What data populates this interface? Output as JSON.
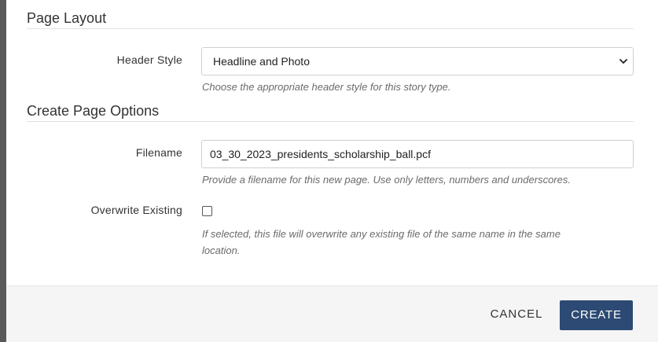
{
  "sections": {
    "page_layout": {
      "title": "Page Layout",
      "header_style": {
        "label": "Header Style",
        "selected": "Headline and Photo",
        "help": "Choose the appropriate header style for this story type."
      }
    },
    "create_page_options": {
      "title": "Create Page Options",
      "filename": {
        "label": "Filename",
        "value": "03_30_2023_presidents_scholarship_ball.pcf",
        "help": "Provide a filename for this new page. Use only letters, numbers and underscores."
      },
      "overwrite": {
        "label": "Overwrite Existing",
        "checked": false,
        "help_line1": "If selected, this file will overwrite any existing file of the same name in the same",
        "help_line2": "location."
      }
    }
  },
  "footer": {
    "cancel_label": "CANCEL",
    "create_label": "CREATE"
  },
  "colors": {
    "primary_button": "#2c4a73",
    "overlay": "#5a5a5a"
  }
}
